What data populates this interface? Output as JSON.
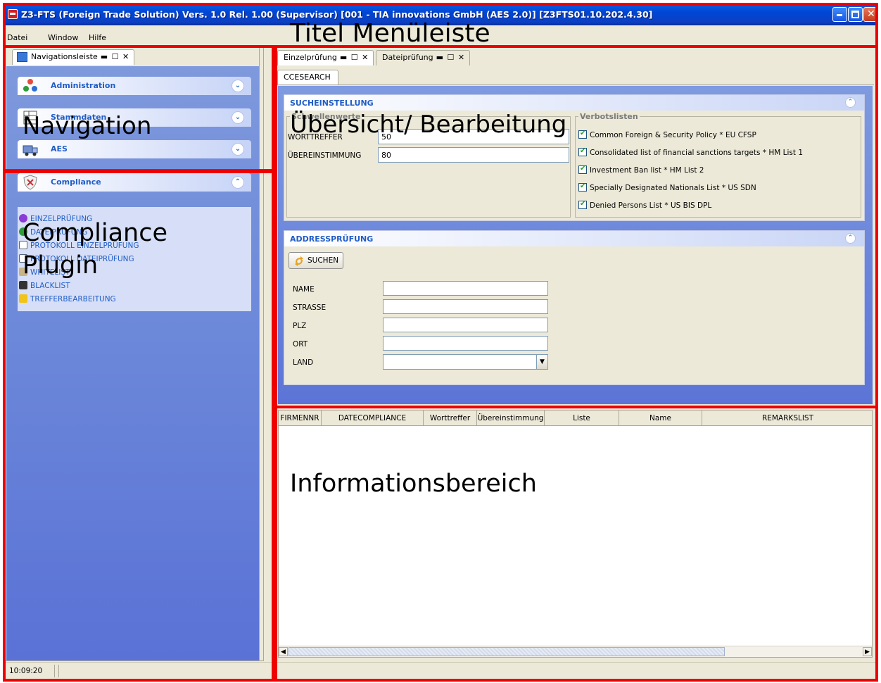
{
  "window": {
    "title": "Z3-FTS (Foreign Trade Solution) Vers. 1.0 Rel. 1.00 (Supervisor) [001 - TIA innovations GmbH (AES 2.0)] [Z3FTS01.10.202.4.30]"
  },
  "menu": {
    "items": [
      "Datei",
      "Window",
      "Hilfe"
    ]
  },
  "left_view": {
    "tab_label": "Navigationsleiste",
    "tab_controls": "▬ ☐ ✕"
  },
  "navigation": {
    "groups": [
      {
        "label": "Administration",
        "icon": "people-icon",
        "chevron": "⌄"
      },
      {
        "label": "Stammdaten",
        "icon": "table-icon",
        "chevron": "⌄"
      },
      {
        "label": "AES",
        "icon": "truck-icon",
        "chevron": "⌄"
      }
    ]
  },
  "compliance": {
    "label": "Compliance",
    "icon": "shield-icon",
    "chevron": "⌃",
    "items": [
      "EINZELPRÜFUNG",
      "DATEIPRÜFUNG",
      "PROTOKOLL EINZELPRÜFUNG",
      "PROTOKOLL DATEIPRÜFUNG",
      "WHITELIST",
      "BLACKLIST",
      "TREFFERBEARBEITUNG"
    ]
  },
  "editor_tabs": [
    {
      "label": "Einzelprüfung",
      "controls": "▬ ☐ ✕"
    },
    {
      "label": "Dateiprüfung",
      "controls": "▬ ☐ ✕"
    }
  ],
  "sub_tab": "CCESEARCH",
  "search_settings": {
    "title": "SUCHEINSTELLUNG",
    "thresholds_legend": "Schwellenwerte",
    "worttreffer_label": "WORTTREFFER",
    "worttreffer_value": "50",
    "uebereinstimmung_label": "ÜBEREINSTIMMUNG",
    "uebereinstimmung_value": "80",
    "lists_legend": "Verbotslisten",
    "lists": [
      {
        "label": "Common Foreign & Security Policy * EU CFSP",
        "checked": true
      },
      {
        "label": "Consolidated list of financial sanctions targets * HM List 1",
        "checked": true
      },
      {
        "label": "Investment Ban list * HM List 2",
        "checked": true
      },
      {
        "label": "Specially Designated Nationals List * US SDN",
        "checked": true
      },
      {
        "label": "Denied Persons List * US BIS DPL",
        "checked": true
      }
    ]
  },
  "address_check": {
    "title": "ADDRESSPRÜFUNG",
    "search_button": "SUCHEN",
    "fields": [
      {
        "label": "NAME",
        "value": ""
      },
      {
        "label": "STRASSE",
        "value": ""
      },
      {
        "label": "PLZ",
        "value": ""
      },
      {
        "label": "ORT",
        "value": ""
      },
      {
        "label": "LAND",
        "value": ""
      }
    ]
  },
  "results_table": {
    "columns": [
      "FIRMENNR",
      "DATECOMPLIANCE",
      "Worttreffer",
      "Übereinstimmung",
      "Liste",
      "Name",
      "REMARKSLIST"
    ],
    "rows": []
  },
  "status": {
    "time": "10:09:20"
  },
  "annotations": {
    "title_menu": "Titel Menüleiste",
    "navigation": "Navigation",
    "overview": "Übersicht/ Bearbeitung",
    "compliance_plugin_line1": "Compliance",
    "compliance_plugin_line2": "Plugin",
    "information_area": "Informationsbereich"
  },
  "colors": {
    "annotation": "#ee0000",
    "link_blue": "#215dc6",
    "titlebar_blue": "#0046d5"
  }
}
